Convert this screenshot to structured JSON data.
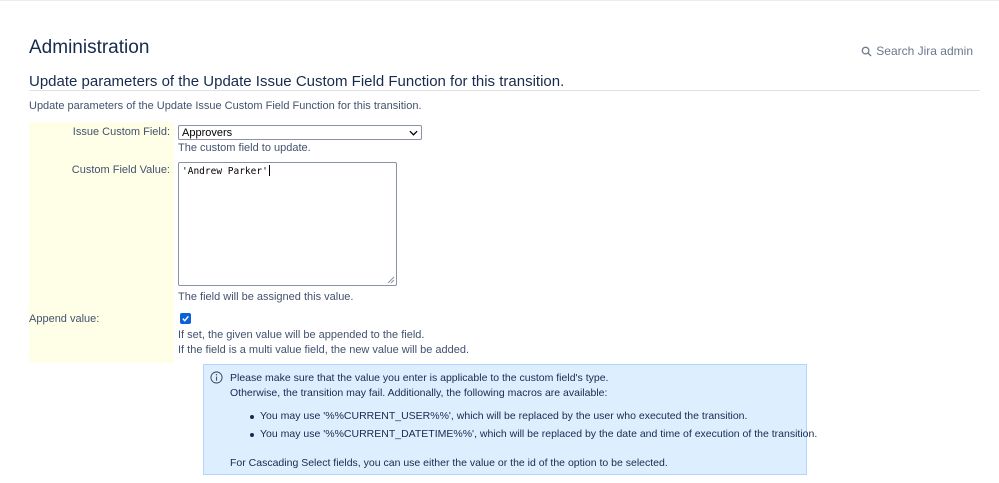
{
  "header": {
    "title": "Administration",
    "search_label": "Search Jira admin"
  },
  "section": {
    "title": "Update parameters of the Update Issue Custom Field Function for this transition.",
    "description": "Update parameters of the Update Issue Custom Field Function for this transition."
  },
  "form": {
    "custom_field": {
      "label": "Issue Custom Field:",
      "selected": "Approvers",
      "help": "The custom field to update."
    },
    "value": {
      "label": "Custom Field Value:",
      "text": "'Andrew Parker'",
      "help": "The field will be assigned this value."
    },
    "append": {
      "label": "Append value:",
      "checked": true,
      "help1": "If set, the given value will be appended to the field.",
      "help2": "If the field is a multi value field, the new value will be added."
    }
  },
  "info": {
    "line1": "Please make sure that the value you enter is applicable to the custom field's type.",
    "line2": "Otherwise, the transition may fail. Additionally, the following macros are available:",
    "bullets": [
      "You may use '%%CURRENT_USER%%', which will be replaced by the user who executed the transition.",
      "You may use '%%CURRENT_DATETIME%%', which will be replaced by the date and time of execution of the transition."
    ],
    "footer": "For Cascading Select fields, you can use either the value or the id of the option to be selected."
  },
  "colors": {
    "checkbox": "#0b62d6",
    "info_bg": "#ddeeff",
    "label_bg": "#ffffe8"
  }
}
